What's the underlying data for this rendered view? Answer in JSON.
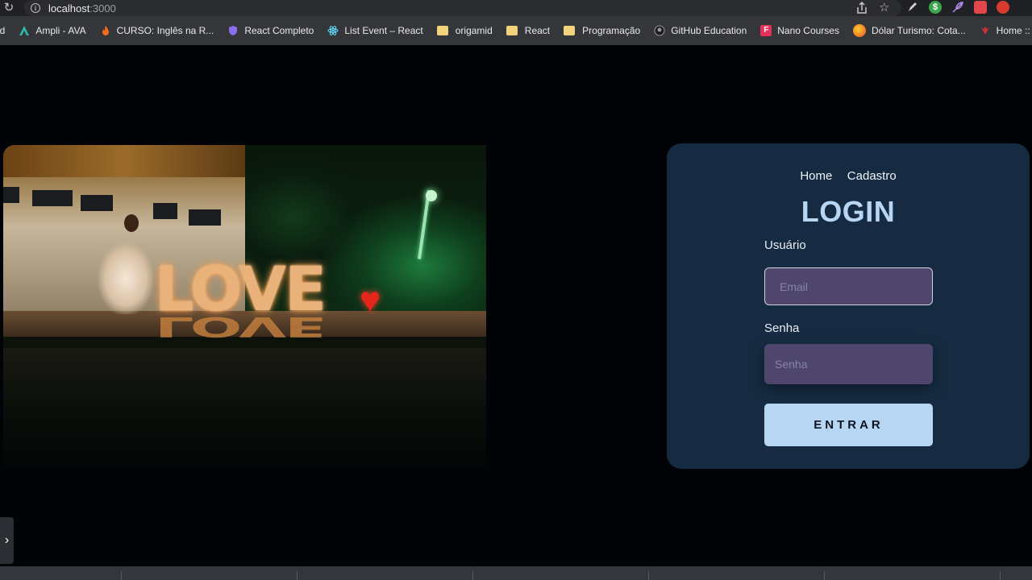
{
  "browser": {
    "url_host": "localhost",
    "url_port": ":3000"
  },
  "bookmarks": [
    {
      "label": "id",
      "icon": "bookmark-icon"
    },
    {
      "label": "Ampli - AVA",
      "icon": "ampli-icon"
    },
    {
      "label": "CURSO: Inglês na R...",
      "icon": "flame-icon"
    },
    {
      "label": "React Completo",
      "icon": "shield-icon"
    },
    {
      "label": "List Event – React",
      "icon": "react-icon"
    },
    {
      "label": "origamid",
      "icon": "folder-icon"
    },
    {
      "label": "React",
      "icon": "folder-icon"
    },
    {
      "label": "Programação",
      "icon": "folder-icon"
    },
    {
      "label": "GitHub Education",
      "icon": "github-icon"
    },
    {
      "label": "Nano Courses",
      "icon": "f-logo-icon"
    },
    {
      "label": "Dólar Turismo: Cota...",
      "icon": "coin-icon"
    },
    {
      "label": "Home :: BJ-Share ::...",
      "icon": "bj-share-icon"
    }
  ],
  "hero": {
    "love_text": "LOVE",
    "heart": "♥"
  },
  "nav": {
    "home": "Home",
    "cadastro": "Cadastro"
  },
  "login": {
    "title": "LOGIN",
    "user_label": "Usuário",
    "user_placeholder": "Email",
    "pass_label": "Senha",
    "pass_placeholder": "Senha",
    "submit": "ENTRAR"
  },
  "colors": {
    "card_bg": "#162b41",
    "accent": "#b6d6f4",
    "input_bg": "#4e466c"
  }
}
